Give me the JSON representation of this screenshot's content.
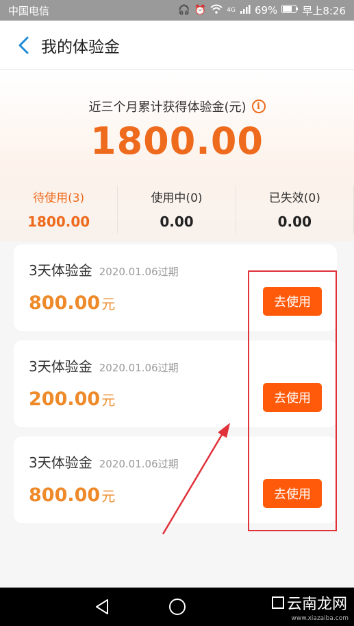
{
  "status_bar": {
    "carrier": "中国电信",
    "network": "4G",
    "battery": "69%",
    "time": "早上8:26"
  },
  "header": {
    "title": "我的体验金"
  },
  "summary": {
    "label": "近三个月累计获得体验金(元)",
    "total": "1800.00",
    "stats": [
      {
        "label": "待使用(3)",
        "value": "1800.00"
      },
      {
        "label": "使用中(0)",
        "value": "0.00"
      },
      {
        "label": "已失效(0)",
        "value": "0.00"
      }
    ]
  },
  "cards": [
    {
      "name": "3天体验金",
      "expire": "2020.01.06过期",
      "amount": "800.00",
      "unit": "元",
      "button": "去使用"
    },
    {
      "name": "3天体验金",
      "expire": "2020.01.06过期",
      "amount": "200.00",
      "unit": "元",
      "button": "去使用"
    },
    {
      "name": "3天体验金",
      "expire": "2020.01.06过期",
      "amount": "800.00",
      "unit": "元",
      "button": "去使用"
    }
  ],
  "watermark": {
    "text": "云南龙网",
    "sub": "www.xiazaiba.com"
  },
  "colors": {
    "accent": "#ee6a1c",
    "button": "#ff5a0a",
    "amount": "#ee8a2a",
    "annotation": "#e0313a"
  }
}
